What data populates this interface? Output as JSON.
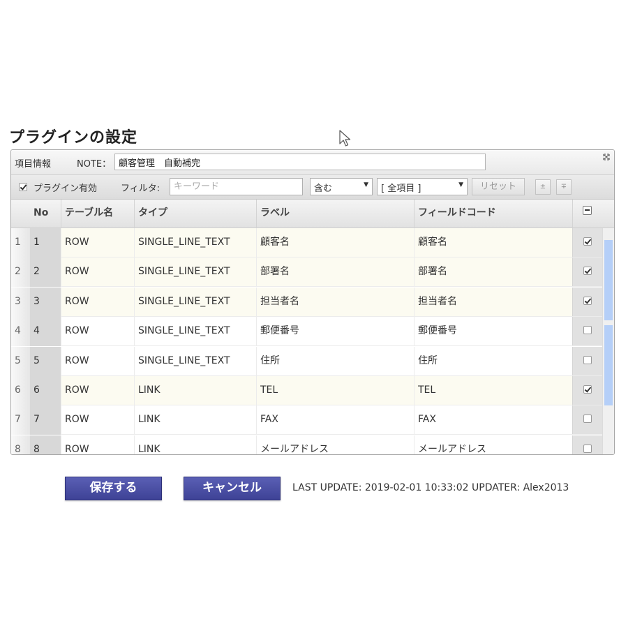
{
  "page_title": "プラグインの設定",
  "info_bar": {
    "label": "項目情報",
    "note_label": "NOTE：",
    "note_value": "顧客管理　自動補完"
  },
  "filter_bar": {
    "enable_label": "プラグイン有効",
    "enabled": true,
    "filter_label": "フィルタ:",
    "keyword_placeholder": "キーワード",
    "match_value": "含む",
    "field_value": "[ 全項目 ]",
    "reset_label": "リセット",
    "move_down_icon": "±",
    "move_top_icon": "∓"
  },
  "table": {
    "headers": {
      "no": "No",
      "table_name": "テーブル名",
      "type": "タイプ",
      "label": "ラベル",
      "field_code": "フィールドコード"
    },
    "rows": [
      {
        "idx": "1",
        "no": "1",
        "table_name": "ROW",
        "type": "SINGLE_LINE_TEXT",
        "label": "顧客名",
        "field_code": "顧客名",
        "checked": true
      },
      {
        "idx": "2",
        "no": "2",
        "table_name": "ROW",
        "type": "SINGLE_LINE_TEXT",
        "label": "部署名",
        "field_code": "部署名",
        "checked": true
      },
      {
        "idx": "3",
        "no": "3",
        "table_name": "ROW",
        "type": "SINGLE_LINE_TEXT",
        "label": "担当者名",
        "field_code": "担当者名",
        "checked": true
      },
      {
        "idx": "4",
        "no": "4",
        "table_name": "ROW",
        "type": "SINGLE_LINE_TEXT",
        "label": "郵便番号",
        "field_code": "郵便番号",
        "checked": false
      },
      {
        "idx": "5",
        "no": "5",
        "table_name": "ROW",
        "type": "SINGLE_LINE_TEXT",
        "label": "住所",
        "field_code": "住所",
        "checked": false
      },
      {
        "idx": "6",
        "no": "6",
        "table_name": "ROW",
        "type": "LINK",
        "label": "TEL",
        "field_code": "TEL",
        "checked": true
      },
      {
        "idx": "7",
        "no": "7",
        "table_name": "ROW",
        "type": "LINK",
        "label": "FAX",
        "field_code": "FAX",
        "checked": false
      },
      {
        "idx": "8",
        "no": "8",
        "table_name": "ROW",
        "type": "LINK",
        "label": "メールアドレス",
        "field_code": "メールアドレス",
        "checked": false
      }
    ]
  },
  "footer": {
    "save_label": "保存する",
    "cancel_label": "キャンセル",
    "update_text": "LAST UPDATE: 2019-02-01 10:33:02 UPDATER: Alex2013"
  },
  "icons": {
    "cursor": "mouse-pointer-icon",
    "expand": "expand-icon",
    "header_checkbox": "minus-checkbox-icon"
  },
  "colors": {
    "button": "#4a4fa6",
    "checked_row": "#fcfbf1",
    "scroll_thumb": "#b5cff8"
  }
}
